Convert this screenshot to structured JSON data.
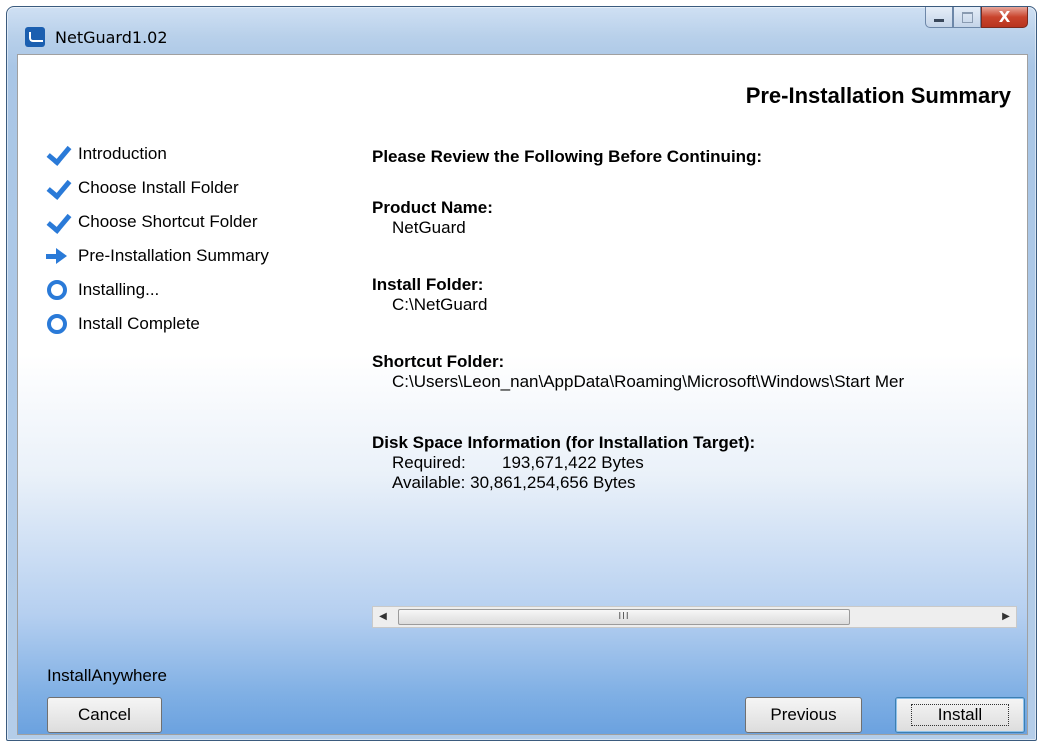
{
  "window": {
    "title": "NetGuard1.02",
    "close_glyph": "X"
  },
  "header": {
    "title": "Pre-Installation Summary"
  },
  "steps": [
    {
      "label": "Introduction",
      "state": "done",
      "icon": "check-icon"
    },
    {
      "label": "Choose Install Folder",
      "state": "done",
      "icon": "check-icon"
    },
    {
      "label": "Choose Shortcut Folder",
      "state": "done",
      "icon": "check-icon"
    },
    {
      "label": "Pre-Installation Summary",
      "state": "current",
      "icon": "arrow-right-icon"
    },
    {
      "label": "Installing...",
      "state": "pending",
      "icon": "circle-icon"
    },
    {
      "label": "Install Complete",
      "state": "pending",
      "icon": "circle-icon"
    }
  ],
  "summary": {
    "intro": "Please Review the Following Before Continuing:",
    "product_name_label": "Product Name:",
    "product_name": "NetGuard",
    "install_folder_label": "Install Folder:",
    "install_folder": "C:\\NetGuard",
    "shortcut_folder_label": "Shortcut Folder:",
    "shortcut_folder": "C:\\Users\\Leon_nan\\AppData\\Roaming\\Microsoft\\Windows\\Start Mer",
    "disk_label": "Disk Space Information (for Installation Target):",
    "required_label": "Required:",
    "required_value": "193,671,422 Bytes",
    "available_label": "Available:",
    "available_value": "30,861,254,656 Bytes"
  },
  "scrollbar": {
    "thumb_glyph": "III",
    "left_arrow": "◀",
    "right_arrow": "▶"
  },
  "footer": {
    "vendor": "InstallAnywhere",
    "cancel": "Cancel",
    "previous": "Previous",
    "install": "Install"
  },
  "colors": {
    "accent": "#2a7ad8",
    "gradient_bottom": "#6aa1df"
  }
}
